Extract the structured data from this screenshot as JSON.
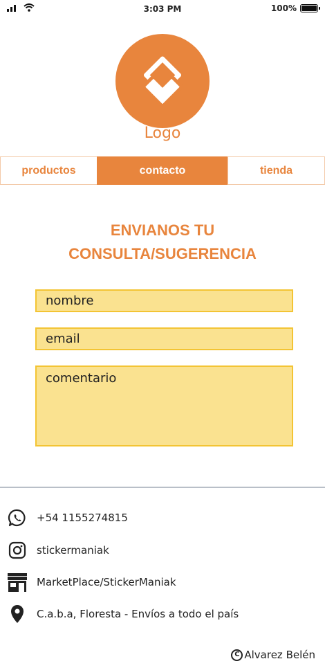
{
  "status_bar": {
    "time": "3:03 PM",
    "battery_text": "100%",
    "battery_level": 1.0,
    "icons": [
      "signal-icon",
      "wifi-icon",
      "battery-icon"
    ]
  },
  "logo": {
    "label": "Logo",
    "color": "#e8853d"
  },
  "tabs": [
    {
      "label": "productos",
      "active": false
    },
    {
      "label": "contacto",
      "active": true
    },
    {
      "label": "tienda",
      "active": false
    }
  ],
  "form": {
    "title_line1": "ENVIANOS TU",
    "title_line2": "CONSULTA/SUGERENCIA",
    "name_placeholder": "nombre",
    "email_placeholder": "email",
    "comment_placeholder": "comentario"
  },
  "footer": {
    "phone": "+54 1155274815",
    "instagram": "stickermaniak",
    "marketplace": "MarketPlace/StickerManiak",
    "location": "C.a.b.a, Floresta - Envíos a todo el país",
    "credit": "Alvarez Belén",
    "icons": [
      "whatsapp-icon",
      "instagram-icon",
      "store-icon",
      "location-pin-icon",
      "copyright-icon"
    ]
  },
  "colors": {
    "accent": "#e8853d",
    "field_bg": "#fae290",
    "field_border": "#f3c434",
    "divider": "#b9bfc8"
  }
}
